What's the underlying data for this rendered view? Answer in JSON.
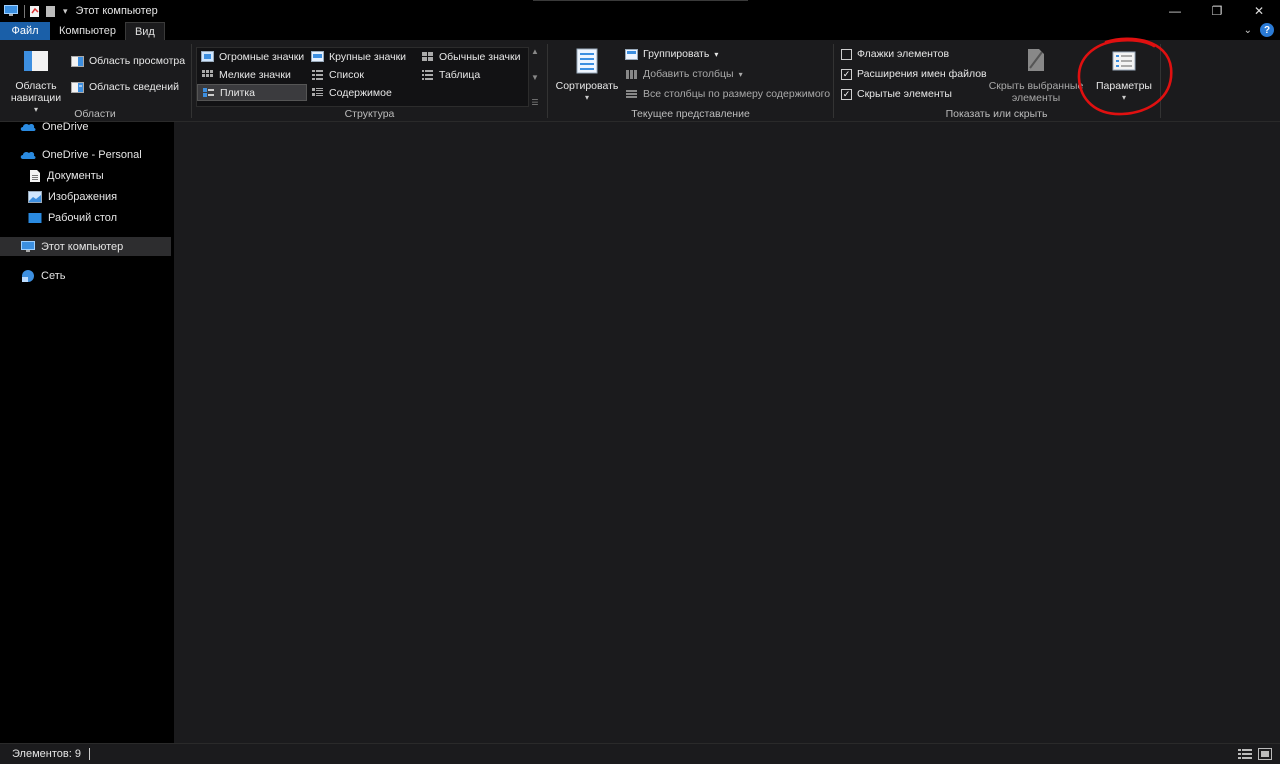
{
  "window": {
    "title": "Этот компьютер"
  },
  "tabs": [
    {
      "label": "Файл"
    },
    {
      "label": "Компьютер"
    },
    {
      "label": "Вид"
    }
  ],
  "ribbon": {
    "panes": {
      "label": "Области",
      "nav_pane": "Область навигации",
      "preview_pane": "Область просмотра",
      "details_pane": "Область сведений"
    },
    "layout": {
      "label": "Структура",
      "items": [
        "Огромные значки",
        "Крупные значки",
        "Обычные значки",
        "Мелкие значки",
        "Список",
        "Таблица",
        "Плитка",
        "Содержимое"
      ],
      "selected": "Плитка"
    },
    "current_view": {
      "label": "Текущее представление",
      "sort": "Сортировать",
      "group": "Группировать",
      "add_columns": "Добавить столбцы",
      "fit_columns": "Все столбцы по размеру содержимого"
    },
    "show_hide": {
      "label": "Показать или скрыть",
      "item_checkboxes": {
        "label": "Флажки элементов",
        "checked": false
      },
      "file_extensions": {
        "label": "Расширения имен файлов",
        "checked": true
      },
      "hidden_items": {
        "label": "Скрытые элементы",
        "checked": true
      },
      "hide_selected": "Скрыть выбранные элементы"
    },
    "options": {
      "label": "Параметры"
    }
  },
  "nav": {
    "items": [
      {
        "label": "OneDrive",
        "icon": "cloud-icon"
      },
      {
        "label": "OneDrive - Personal",
        "icon": "cloud-icon"
      },
      {
        "label": "Документы",
        "icon": "document-icon"
      },
      {
        "label": "Изображения",
        "icon": "pictures-icon"
      },
      {
        "label": "Рабочий стол",
        "icon": "desktop-folder-icon"
      },
      {
        "label": "Этот компьютер",
        "icon": "computer-icon",
        "selected": true
      },
      {
        "label": "Сеть",
        "icon": "network-icon"
      }
    ]
  },
  "status": {
    "count": "Элементов: 9"
  },
  "colors": {
    "accent": "#1a5fa8",
    "annotation": "#e01010"
  }
}
